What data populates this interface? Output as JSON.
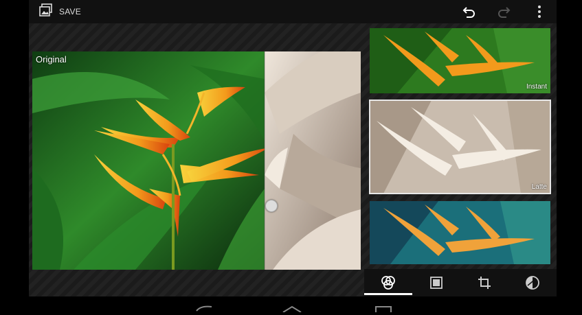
{
  "actionbar": {
    "save_label": "SAVE",
    "icons": [
      "gallery-icon",
      "undo-icon",
      "redo-icon",
      "overflow-menu-icon"
    ]
  },
  "main_image": {
    "label": "Original",
    "split_position": 0.71
  },
  "filters": [
    {
      "label": "Instant",
      "selected": false
    },
    {
      "label": "Latte",
      "selected": true
    },
    {
      "label": "",
      "selected": false
    }
  ],
  "tools": {
    "items": [
      "filters-icon",
      "frames-icon",
      "crop-icon",
      "adjust-icon"
    ],
    "selected": "filters-icon"
  },
  "navbar": {
    "icons": [
      "back-icon",
      "home-icon",
      "recents-icon"
    ]
  },
  "colors": {
    "accent": "#ffffff",
    "bar": "#111111"
  }
}
